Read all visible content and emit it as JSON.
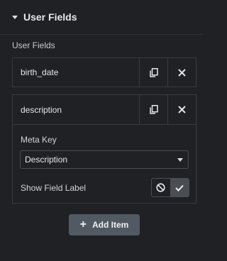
{
  "section": {
    "title": "User Fields"
  },
  "control": {
    "label": "User Fields"
  },
  "items": [
    {
      "title": "birth_date",
      "expanded": false
    },
    {
      "title": "description",
      "expanded": true,
      "meta_key_label": "Meta Key",
      "meta_key_value": "Description",
      "show_label_label": "Show Field Label",
      "show_label_selected": "yes"
    }
  ],
  "add_button": {
    "label": "Add Item"
  },
  "icons": {
    "caret": "caret-down-icon",
    "duplicate": "copy-icon",
    "remove": "close-icon",
    "no": "ban-icon",
    "yes": "check-icon",
    "add": "plus-icon"
  },
  "colors": {
    "background": "#1f2124",
    "border": "#393b40",
    "button": "#515962",
    "active": "#4a4d52"
  }
}
